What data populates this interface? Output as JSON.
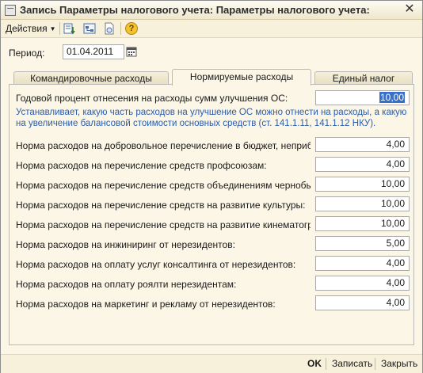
{
  "window": {
    "title": "Запись Параметры налогового учета: Параметры налогового учета:",
    "close_symbol": "✕"
  },
  "toolbar": {
    "actions_label": "Действия",
    "help_symbol": "?"
  },
  "period": {
    "label": "Период:",
    "value": "01.04.2011"
  },
  "tabs": [
    {
      "label": "Командировочные расходы",
      "active": false
    },
    {
      "label": "Нормируемые расходы",
      "active": true
    },
    {
      "label": "Единый налог",
      "active": false
    }
  ],
  "main": {
    "annual_label": "Годовой процент отнесения на расходы сумм улучшения ОС:",
    "annual_value": "10,00",
    "hint": "Устанавливает, какую часть расходов на улучшение ОС можно отнести на расходы, а какую на увеличение балансовой стоимости основных средств (ст. 141.1.11, 141.1.12 НКУ).",
    "norms": [
      {
        "label": "Норма расходов на добровольное перечисление в бюджет, неприбыль...",
        "value": "4,00"
      },
      {
        "label": "Норма расходов на перечисление средств профсоюзам:",
        "value": "4,00"
      },
      {
        "label": "Норма расходов на перечисление средств объединениям чернобыльц...",
        "value": "10,00"
      },
      {
        "label": "Норма расходов на перечисление средств на развитие культуры:",
        "value": "10,00"
      },
      {
        "label": "Норма расходов на перечисление средств на развитие кинематографа:",
        "value": "10,00"
      },
      {
        "label": "Норма расходов на инжиниринг от нерезидентов:",
        "value": "5,00"
      },
      {
        "label": "Норма расходов на оплату услуг консалтинга от нерезидентов:",
        "value": "4,00"
      },
      {
        "label": "Норма расходов на оплату роялти нерезидентам:",
        "value": "4,00"
      },
      {
        "label": "Норма расходов на маркетинг и рекламу от нерезидентов:",
        "value": "4,00"
      }
    ]
  },
  "footer": {
    "ok_label": "OK",
    "save_label": "Записать",
    "close_label": "Закрыть"
  }
}
